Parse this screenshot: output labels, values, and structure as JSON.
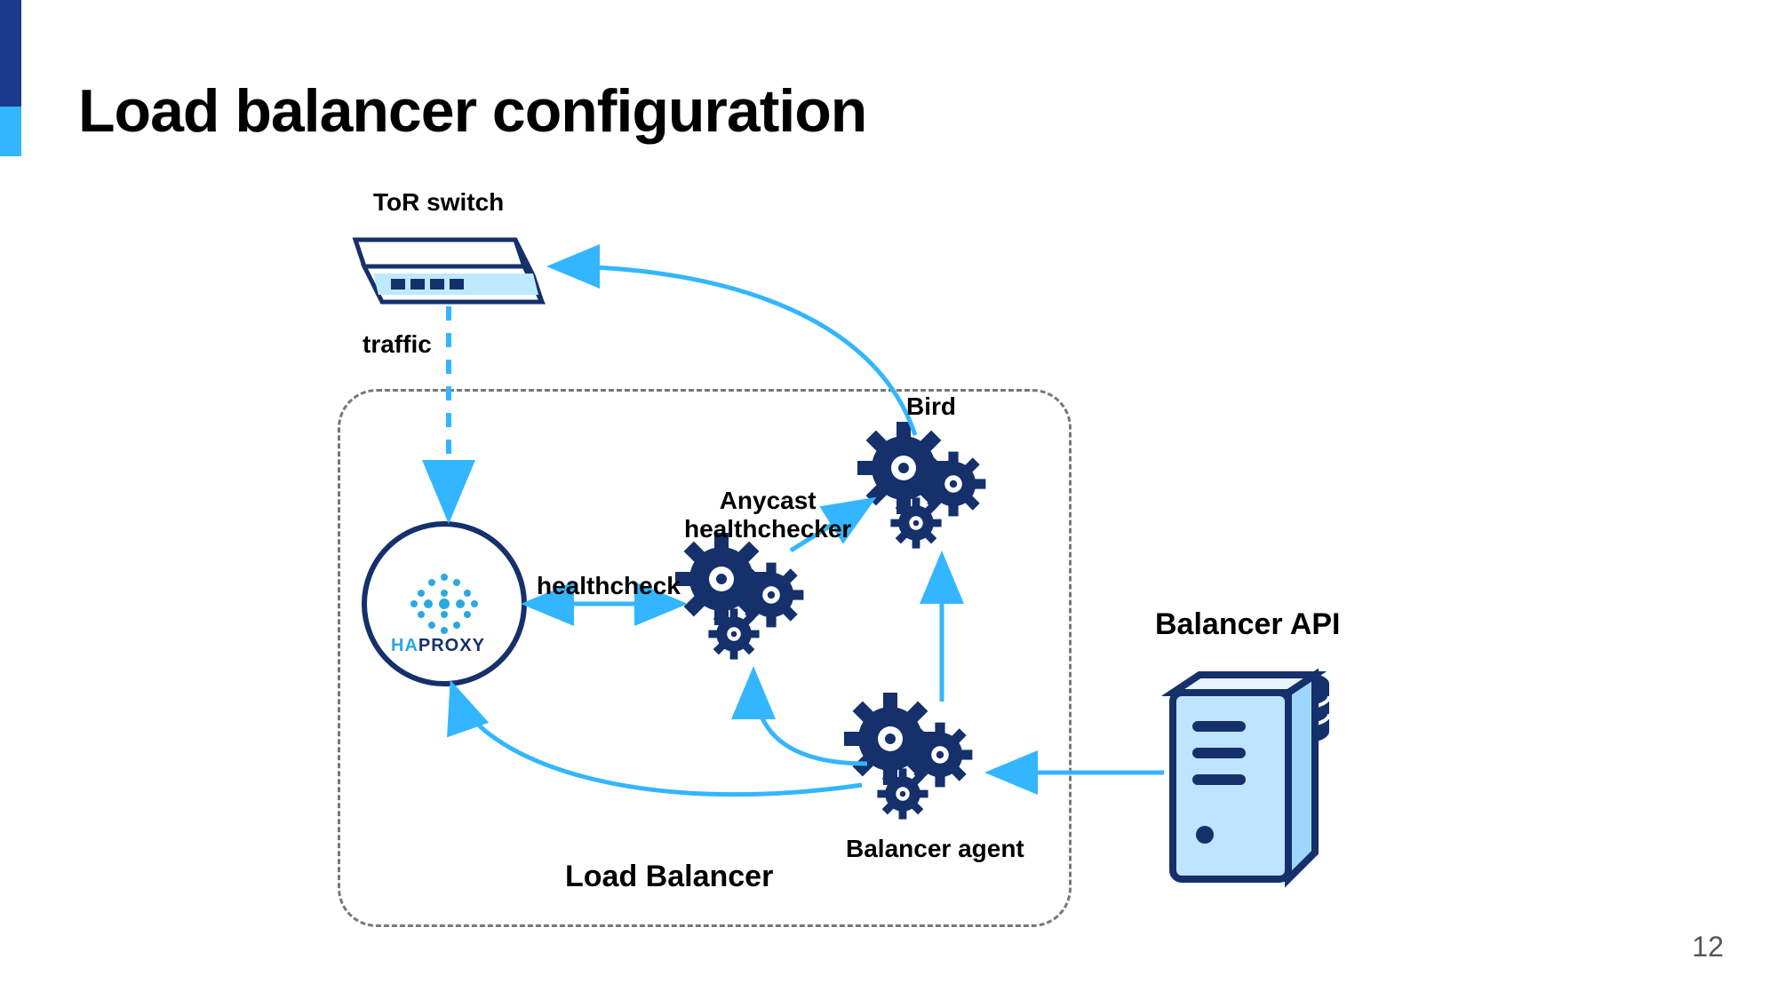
{
  "title": "Load balancer configuration",
  "page_number": "12",
  "nodes": {
    "tor_switch": "ToR switch",
    "traffic": "traffic",
    "haproxy": "HAPROXY",
    "healthcheck": "healthcheck",
    "anycast_healthchecker": "Anycast\nhealthchecker",
    "bird": "Bird",
    "balancer_agent": "Balancer agent",
    "load_balancer": "Load Balancer",
    "balancer_api": "Balancer API"
  },
  "colors": {
    "arrow": "#33b6ff",
    "navy": "#15306b",
    "navy2": "#0e2a66"
  }
}
